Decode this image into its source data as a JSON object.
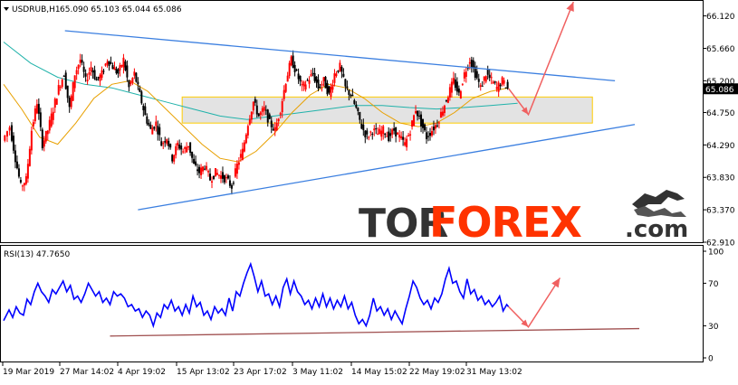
{
  "header": {
    "symbol_timeframe": "USDRUB,H1",
    "ohlc": "65.090 65.103 65.044 65.086",
    "rsi_label": "RSI(13) 47.7650"
  },
  "watermark": {
    "part1": "TOR",
    "part2": "FOREX",
    "part3": ".com"
  },
  "colors": {
    "bull_candle": "#ff0000",
    "bear_candle": "#000000",
    "trendline": "#3b7fe0",
    "ma_fast": "#e8a000",
    "ma_slow": "#20b2aa",
    "zone_fill": "#d9d9d9",
    "zone_border": "#ffcc00",
    "forecast_arrow": "#f06060",
    "rsi_line": "#0000ff",
    "rsi_trend": "#a05050",
    "current_price_bg": "#000000"
  },
  "chart_data": [
    {
      "type": "candlestick",
      "title": "USDRUB,H1",
      "ylim": [
        62.91,
        66.32
      ],
      "yticks": [
        "66.120",
        "65.660",
        "65.200",
        "64.750",
        "64.290",
        "63.830",
        "63.370",
        "62.910"
      ],
      "current_price": "65.086",
      "xticks": [
        "19 Mar 2019",
        "27 Mar 14:02",
        "4 Apr 19:02",
        "15 Apr 13:02",
        "23 Apr 17:02",
        "3 May 11:02",
        "14 May 15:02",
        "22 May 19:02",
        "31 May 13:02"
      ],
      "close_path": [
        [
          0,
          64.35
        ],
        [
          8,
          64.55
        ],
        [
          14,
          64.1
        ],
        [
          20,
          63.7
        ],
        [
          26,
          63.8
        ],
        [
          32,
          64.5
        ],
        [
          38,
          64.9
        ],
        [
          44,
          64.3
        ],
        [
          50,
          64.5
        ],
        [
          56,
          64.8
        ],
        [
          62,
          65.1
        ],
        [
          68,
          65.3
        ],
        [
          74,
          64.8
        ],
        [
          80,
          65.3
        ],
        [
          86,
          65.5
        ],
        [
          92,
          65.2
        ],
        [
          98,
          65.4
        ],
        [
          104,
          65.2
        ],
        [
          110,
          65.3
        ],
        [
          116,
          65.5
        ],
        [
          122,
          65.4
        ],
        [
          128,
          65.3
        ],
        [
          134,
          65.5
        ],
        [
          140,
          65.1
        ],
        [
          146,
          65.3
        ],
        [
          152,
          65.0
        ],
        [
          158,
          64.7
        ],
        [
          164,
          64.5
        ],
        [
          170,
          64.6
        ],
        [
          176,
          64.3
        ],
        [
          182,
          64.4
        ],
        [
          188,
          64.1
        ],
        [
          194,
          64.3
        ],
        [
          200,
          64.2
        ],
        [
          206,
          64.3
        ],
        [
          212,
          64.0
        ],
        [
          218,
          63.9
        ],
        [
          224,
          64.0
        ],
        [
          230,
          63.8
        ],
        [
          236,
          63.9
        ],
        [
          242,
          63.85
        ],
        [
          248,
          63.8
        ],
        [
          254,
          63.7
        ],
        [
          260,
          64.0
        ],
        [
          266,
          64.2
        ],
        [
          272,
          64.6
        ],
        [
          278,
          64.9
        ],
        [
          284,
          64.7
        ],
        [
          290,
          64.8
        ],
        [
          296,
          64.6
        ],
        [
          302,
          64.5
        ],
        [
          308,
          64.8
        ],
        [
          314,
          65.2
        ],
        [
          320,
          65.5
        ],
        [
          326,
          65.3
        ],
        [
          332,
          65.1
        ],
        [
          338,
          65.2
        ],
        [
          344,
          65.3
        ],
        [
          350,
          65.1
        ],
        [
          356,
          65.2
        ],
        [
          362,
          65.0
        ],
        [
          368,
          65.3
        ],
        [
          374,
          65.4
        ],
        [
          380,
          65.1
        ],
        [
          386,
          65.0
        ],
        [
          392,
          64.8
        ],
        [
          398,
          64.55
        ],
        [
          404,
          64.4
        ],
        [
          410,
          64.5
        ],
        [
          416,
          64.45
        ],
        [
          422,
          64.5
        ],
        [
          428,
          64.4
        ],
        [
          434,
          64.5
        ],
        [
          440,
          64.4
        ],
        [
          446,
          64.3
        ],
        [
          452,
          64.5
        ],
        [
          458,
          64.8
        ],
        [
          464,
          64.6
        ],
        [
          470,
          64.4
        ],
        [
          476,
          64.5
        ],
        [
          482,
          64.6
        ],
        [
          488,
          64.8
        ],
        [
          494,
          65.0
        ],
        [
          500,
          65.2
        ],
        [
          506,
          65.0
        ],
        [
          512,
          65.3
        ],
        [
          518,
          65.5
        ],
        [
          524,
          65.3
        ],
        [
          530,
          65.1
        ],
        [
          536,
          65.3
        ],
        [
          542,
          65.2
        ],
        [
          548,
          65.1
        ],
        [
          554,
          65.2
        ],
        [
          560,
          65.09
        ]
      ],
      "ma_fast": [
        [
          0,
          65.15
        ],
        [
          20,
          64.8
        ],
        [
          40,
          64.4
        ],
        [
          60,
          64.3
        ],
        [
          80,
          64.6
        ],
        [
          100,
          64.95
        ],
        [
          120,
          65.15
        ],
        [
          140,
          65.2
        ],
        [
          160,
          65.05
        ],
        [
          180,
          64.8
        ],
        [
          200,
          64.55
        ],
        [
          220,
          64.3
        ],
        [
          240,
          64.1
        ],
        [
          260,
          64.05
        ],
        [
          280,
          64.2
        ],
        [
          300,
          64.45
        ],
        [
          320,
          64.75
        ],
        [
          340,
          65.0
        ],
        [
          360,
          65.15
        ],
        [
          380,
          65.1
        ],
        [
          400,
          64.95
        ],
        [
          420,
          64.75
        ],
        [
          440,
          64.6
        ],
        [
          460,
          64.55
        ],
        [
          480,
          64.6
        ],
        [
          500,
          64.75
        ],
        [
          520,
          64.95
        ],
        [
          540,
          65.05
        ],
        [
          560,
          65.1
        ]
      ],
      "ma_slow": [
        [
          0,
          65.75
        ],
        [
          30,
          65.45
        ],
        [
          60,
          65.25
        ],
        [
          90,
          65.15
        ],
        [
          120,
          65.1
        ],
        [
          150,
          65.0
        ],
        [
          180,
          64.9
        ],
        [
          210,
          64.8
        ],
        [
          240,
          64.7
        ],
        [
          270,
          64.65
        ],
        [
          300,
          64.7
        ],
        [
          330,
          64.75
        ],
        [
          360,
          64.8
        ],
        [
          390,
          64.85
        ],
        [
          420,
          64.85
        ],
        [
          450,
          64.82
        ],
        [
          480,
          64.8
        ],
        [
          510,
          64.82
        ],
        [
          540,
          64.85
        ],
        [
          570,
          64.88
        ]
      ],
      "upper_trendline": [
        [
          68,
          65.91
        ],
        [
          678,
          65.2
        ]
      ],
      "lower_trendline": [
        [
          149,
          63.37
        ],
        [
          700,
          64.58
        ]
      ],
      "zone": {
        "y_top": 64.97,
        "y_bottom": 64.6,
        "x_start": 198,
        "x_end": 653
      },
      "forecast": [
        [
          560,
          65.09
        ],
        [
          582,
          64.72
        ],
        [
          632,
          66.32
        ]
      ]
    },
    {
      "type": "line",
      "title": "RSI(13) 47.7650",
      "ylim": [
        0,
        100
      ],
      "yticks": [
        "100",
        "70",
        "30",
        "0"
      ],
      "values": [
        [
          0,
          35
        ],
        [
          6,
          45
        ],
        [
          10,
          38
        ],
        [
          14,
          48
        ],
        [
          18,
          42
        ],
        [
          22,
          40
        ],
        [
          26,
          55
        ],
        [
          30,
          50
        ],
        [
          34,
          62
        ],
        [
          38,
          70
        ],
        [
          42,
          62
        ],
        [
          46,
          58
        ],
        [
          50,
          52
        ],
        [
          54,
          64
        ],
        [
          58,
          60
        ],
        [
          62,
          66
        ],
        [
          66,
          72
        ],
        [
          70,
          62
        ],
        [
          74,
          68
        ],
        [
          78,
          55
        ],
        [
          82,
          58
        ],
        [
          86,
          52
        ],
        [
          90,
          60
        ],
        [
          94,
          70
        ],
        [
          98,
          64
        ],
        [
          102,
          58
        ],
        [
          106,
          62
        ],
        [
          110,
          52
        ],
        [
          114,
          56
        ],
        [
          118,
          50
        ],
        [
          122,
          62
        ],
        [
          126,
          58
        ],
        [
          130,
          60
        ],
        [
          134,
          56
        ],
        [
          138,
          48
        ],
        [
          142,
          50
        ],
        [
          146,
          44
        ],
        [
          150,
          46
        ],
        [
          154,
          38
        ],
        [
          158,
          44
        ],
        [
          162,
          40
        ],
        [
          166,
          30
        ],
        [
          170,
          42
        ],
        [
          174,
          38
        ],
        [
          178,
          50
        ],
        [
          182,
          46
        ],
        [
          186,
          54
        ],
        [
          190,
          44
        ],
        [
          194,
          48
        ],
        [
          198,
          40
        ],
        [
          202,
          50
        ],
        [
          206,
          42
        ],
        [
          210,
          58
        ],
        [
          214,
          48
        ],
        [
          218,
          52
        ],
        [
          222,
          40
        ],
        [
          226,
          44
        ],
        [
          230,
          36
        ],
        [
          234,
          48
        ],
        [
          238,
          42
        ],
        [
          242,
          46
        ],
        [
          246,
          40
        ],
        [
          250,
          56
        ],
        [
          254,
          44
        ],
        [
          258,
          62
        ],
        [
          262,
          58
        ],
        [
          266,
          70
        ],
        [
          270,
          80
        ],
        [
          274,
          88
        ],
        [
          278,
          76
        ],
        [
          282,
          62
        ],
        [
          286,
          72
        ],
        [
          290,
          58
        ],
        [
          294,
          60
        ],
        [
          298,
          50
        ],
        [
          302,
          58
        ],
        [
          306,
          48
        ],
        [
          310,
          66
        ],
        [
          314,
          74
        ],
        [
          318,
          60
        ],
        [
          322,
          72
        ],
        [
          326,
          62
        ],
        [
          330,
          58
        ],
        [
          334,
          50
        ],
        [
          338,
          54
        ],
        [
          342,
          46
        ],
        [
          346,
          56
        ],
        [
          350,
          48
        ],
        [
          354,
          60
        ],
        [
          358,
          48
        ],
        [
          362,
          56
        ],
        [
          366,
          46
        ],
        [
          370,
          54
        ],
        [
          374,
          48
        ],
        [
          378,
          58
        ],
        [
          382,
          46
        ],
        [
          386,
          52
        ],
        [
          390,
          40
        ],
        [
          394,
          32
        ],
        [
          398,
          36
        ],
        [
          402,
          30
        ],
        [
          406,
          40
        ],
        [
          410,
          56
        ],
        [
          414,
          44
        ],
        [
          418,
          48
        ],
        [
          422,
          40
        ],
        [
          426,
          46
        ],
        [
          430,
          36
        ],
        [
          434,
          44
        ],
        [
          438,
          38
        ],
        [
          442,
          32
        ],
        [
          446,
          46
        ],
        [
          450,
          58
        ],
        [
          454,
          72
        ],
        [
          458,
          66
        ],
        [
          462,
          56
        ],
        [
          466,
          50
        ],
        [
          470,
          54
        ],
        [
          474,
          46
        ],
        [
          478,
          56
        ],
        [
          482,
          52
        ],
        [
          486,
          60
        ],
        [
          490,
          74
        ],
        [
          494,
          84
        ],
        [
          498,
          70
        ],
        [
          502,
          72
        ],
        [
          506,
          62
        ],
        [
          510,
          56
        ],
        [
          514,
          74
        ],
        [
          518,
          60
        ],
        [
          522,
          64
        ],
        [
          526,
          54
        ],
        [
          530,
          58
        ],
        [
          534,
          50
        ],
        [
          538,
          54
        ],
        [
          542,
          48
        ],
        [
          546,
          52
        ],
        [
          550,
          58
        ],
        [
          554,
          44
        ],
        [
          558,
          50
        ],
        [
          560,
          48
        ]
      ],
      "trendline": [
        [
          118,
          20.5
        ],
        [
          705,
          27.5
        ]
      ],
      "forecast": [
        [
          560,
          48
        ],
        [
          582,
          29
        ],
        [
          617,
          75
        ]
      ]
    }
  ]
}
